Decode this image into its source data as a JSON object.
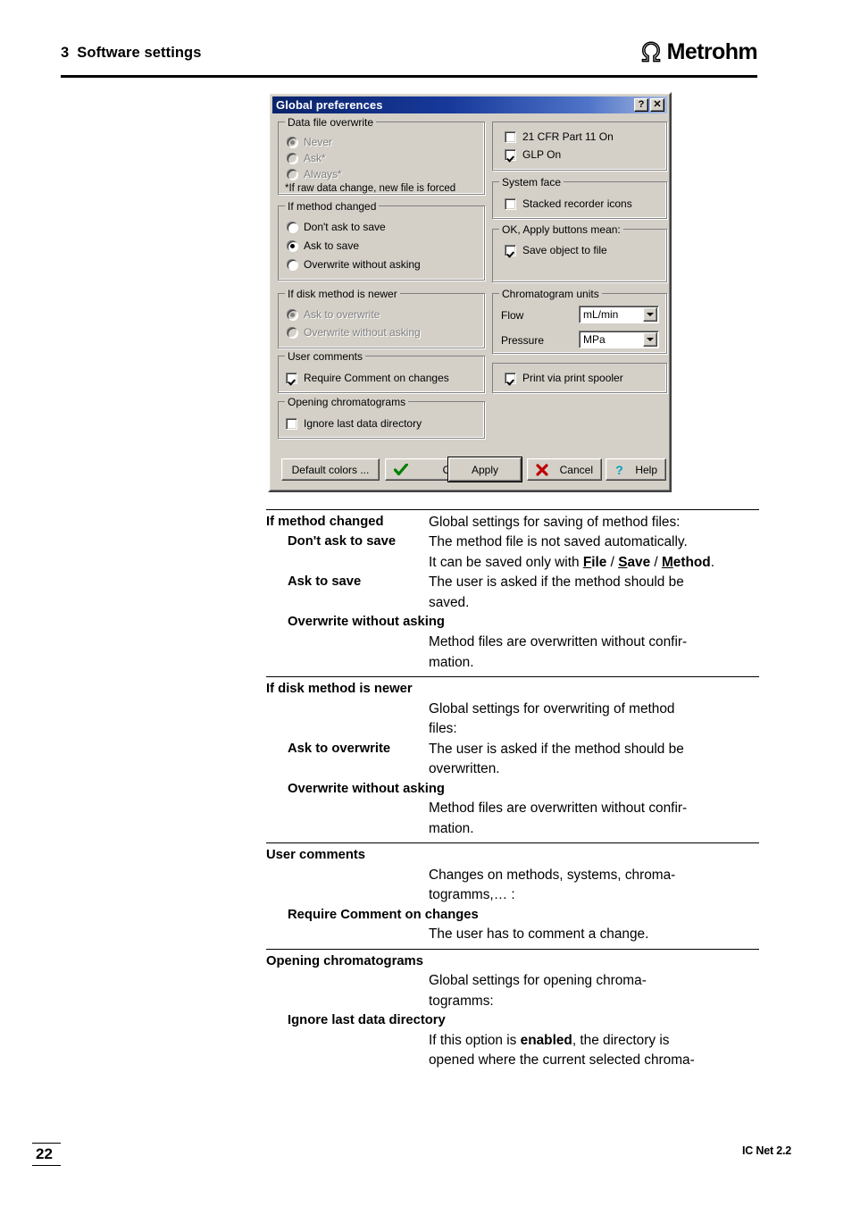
{
  "header": {
    "chapter_number": "3",
    "chapter_title": "Software settings",
    "brand": "Metrohm",
    "brand_mark_icon": "metrohm-omega-logo"
  },
  "footer": {
    "page_number": "22",
    "product": "IC Net 2.2"
  },
  "dialog": {
    "title": "Global preferences",
    "titlebar_help_label": "?",
    "titlebar_close_label": "✕",
    "groups": {
      "data_file_overwrite": {
        "title": "Data file overwrite",
        "options": [
          {
            "label": "Never",
            "selected": true,
            "disabled": true
          },
          {
            "label": "Ask*",
            "selected": false,
            "disabled": true
          },
          {
            "label": "Always*",
            "selected": false,
            "disabled": true
          }
        ],
        "note": "*If raw data change, new file is forced"
      },
      "if_method_changed": {
        "title": "If method changed",
        "options": [
          {
            "label": "Don't ask to save",
            "selected": false,
            "disabled": false
          },
          {
            "label": "Ask to save",
            "selected": true,
            "disabled": false
          },
          {
            "label": "Overwrite without asking",
            "selected": false,
            "disabled": false
          }
        ]
      },
      "if_disk_method_newer": {
        "title": "If disk method is newer",
        "options": [
          {
            "label": "Ask to overwrite",
            "selected": true,
            "disabled": true
          },
          {
            "label": "Overwrite without asking",
            "selected": false,
            "disabled": true
          }
        ]
      },
      "user_comments": {
        "title": "User comments",
        "checkbox_label": "Require Comment on changes",
        "checked": true
      },
      "opening_chromatograms": {
        "title": "Opening chromatograms",
        "checkbox_label": "Ignore last data directory",
        "checked": false
      },
      "compliance": {
        "items": [
          {
            "label": "21 CFR Part 11 On",
            "checked": false
          },
          {
            "label": "GLP On",
            "checked": true
          }
        ]
      },
      "system_face": {
        "title": "System face",
        "checkbox_label": "Stacked recorder icons",
        "checked": false
      },
      "ok_apply_mean": {
        "title": "OK, Apply buttons mean:",
        "checkbox_label": "Save object to file",
        "checked": true
      },
      "chromatogram_units": {
        "title": "Chromatogram units",
        "flow_label": "Flow",
        "flow_value": "mL/min",
        "pressure_label": "Pressure",
        "pressure_value": "MPa"
      },
      "print_spooler": {
        "checkbox_label": "Print via print spooler",
        "checked": true
      }
    },
    "buttons": {
      "default_colors": "Default colors ...",
      "ok": "OK",
      "apply": "Apply",
      "cancel": "Cancel",
      "help": "Help",
      "ok_icon": "green-check-icon",
      "cancel_icon": "red-x-icon",
      "help_icon": "blue-question-icon"
    }
  },
  "descriptions": [
    {
      "term": "If method changed",
      "term_level": 1,
      "definition": "Global settings for saving of method files:",
      "inline": true,
      "children": [
        {
          "term": "Don't ask to save",
          "definition_part1": "The method file is not saved automatically. It can be saved only with ",
          "kb1": "F",
          "kb1_rest": "ile",
          "sep1": " / ",
          "kb2": "S",
          "kb2_rest": "ave",
          "sep2": " / ",
          "kb3": "M",
          "kb3_rest": "ethod",
          "definition_end": ".",
          "inline": true
        },
        {
          "term": "Ask to save",
          "definition": "The user is asked if the method should be saved.",
          "inline": true
        },
        {
          "term": "Overwrite without asking",
          "definition": "Method files are overwritten without confir-mation.",
          "definition_line1": "Method files are overwritten without confir-",
          "definition_line2": "mation.",
          "inline": false
        }
      ]
    },
    {
      "term": "If disk method is newer",
      "term_level": 1,
      "definition_line1": "Global settings for overwriting of method",
      "definition_line2": "files:",
      "inline": false,
      "children": [
        {
          "term": "Ask to overwrite",
          "definition": "The user is asked if the method should be overwritten.",
          "inline": true
        },
        {
          "term": "Overwrite without asking",
          "definition_line1": "Method files are overwritten without confir-",
          "definition_line2": "mation.",
          "inline": false
        }
      ]
    },
    {
      "term": "User comments",
      "term_level": 1,
      "definition_line1": "Changes on methods, systems, chroma-",
      "definition_line2": "togramms,… :",
      "inline": false,
      "children": [
        {
          "term": "Require Comment on changes",
          "definition": "The user has to comment a change.",
          "inline": false
        }
      ]
    },
    {
      "term": "Opening chromatograms",
      "term_level": 1,
      "definition_line1": "Global settings for opening chroma-",
      "definition_line2": "togramms:",
      "inline": false,
      "children": [
        {
          "term": "Ignore last data directory",
          "definition_pre": "If this option is ",
          "definition_bold": "enabled",
          "definition_post": ", the directory is",
          "definition_line2": "opened where the current selected chroma-",
          "inline": false
        }
      ]
    }
  ],
  "desc_text": {
    "s1_term": "If method changed",
    "s1_def": "Global settings for saving of method files:",
    "s1_c1_term": "Don't ask to save",
    "s1_c1_l1": "The method file is not saved automatically.",
    "s1_c1_l2a": "It can be saved only with ",
    "s1_c1_k1": "F",
    "s1_c1_k1r": "ile",
    "s1_c1_sep1": " / ",
    "s1_c1_k2": "S",
    "s1_c1_k2r": "ave",
    "s1_c1_sep2": " / ",
    "s1_c1_k3": "M",
    "s1_c1_k3r": "ethod",
    "s1_c1_end": ".",
    "s1_c2_term": "Ask to save",
    "s1_c2_l1": "The user is asked if the method should be",
    "s1_c2_l2": "saved.",
    "s1_c3_term": "Overwrite without asking",
    "s1_c3_l1": "Method files are overwritten without confir-",
    "s1_c3_l2": "mation.",
    "s2_term": "If disk method is newer",
    "s2_l1": "Global settings for overwriting of method",
    "s2_l2": "files:",
    "s2_c1_term": "Ask to overwrite",
    "s2_c1_l1": "The user is asked if the method should be",
    "s2_c1_l2": "overwritten.",
    "s2_c2_term": "Overwrite without asking",
    "s2_c2_l1": "Method files are overwritten without confir-",
    "s2_c2_l2": "mation.",
    "s3_term": "User comments",
    "s3_l1": "Changes on methods, systems, chroma-",
    "s3_l2": "togramms,… :",
    "s3_c1_term": "Require Comment on changes",
    "s3_c1_l1": "The user has to comment a change.",
    "s4_term": "Opening chromatograms",
    "s4_l1": "Global settings for opening chroma-",
    "s4_l2": "togramms:",
    "s4_c1_term": "Ignore last data directory",
    "s4_c1_pre": "If this option is ",
    "s4_c1_bold": "enabled",
    "s4_c1_post": ", the directory is",
    "s4_c1_l2": "opened where the current selected chroma-"
  }
}
